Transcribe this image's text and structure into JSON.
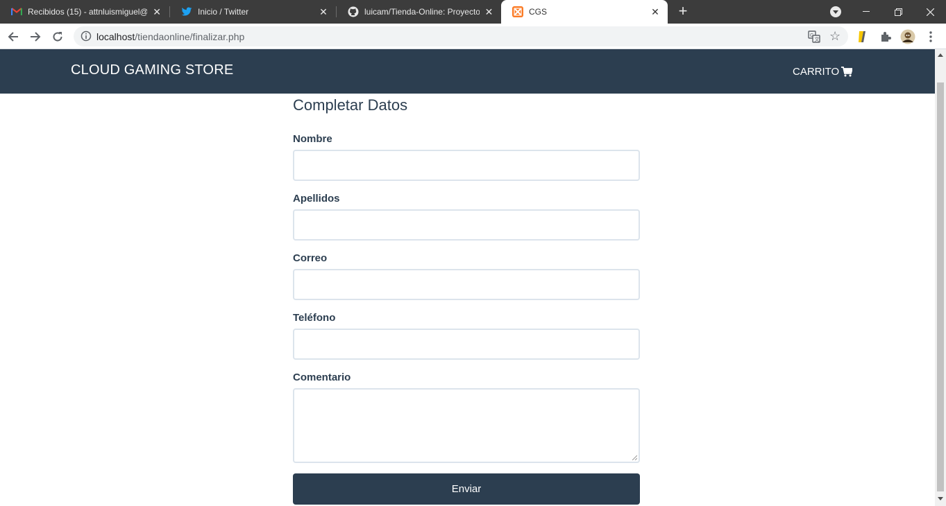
{
  "browser": {
    "tabs": [
      {
        "title": "Recibidos (15) - attnluismiguel@",
        "icon": "gmail-icon",
        "active": false
      },
      {
        "title": "Inicio / Twitter",
        "icon": "twitter-icon",
        "active": false
      },
      {
        "title": "luicam/Tienda-Online: Proyecto d",
        "icon": "github-icon",
        "active": false
      },
      {
        "title": "CGS",
        "icon": "xampp-icon",
        "active": true
      }
    ],
    "address": {
      "host": "localhost",
      "path": "/tiendaonline/finalizar.php"
    }
  },
  "site": {
    "brand": "CLOUD GAMING STORE",
    "cart_label": "CARRITO",
    "colors": {
      "navbar": "#2c3e50",
      "text": "#2c3e50",
      "input_border": "#dce4ec"
    }
  },
  "form": {
    "title": "Completar Datos",
    "fields": [
      {
        "label": "Nombre",
        "value": ""
      },
      {
        "label": "Apellidos",
        "value": ""
      },
      {
        "label": "Correo",
        "value": ""
      },
      {
        "label": "Teléfono",
        "value": ""
      },
      {
        "label": "Comentario",
        "value": ""
      }
    ],
    "submit_label": "Enviar"
  }
}
